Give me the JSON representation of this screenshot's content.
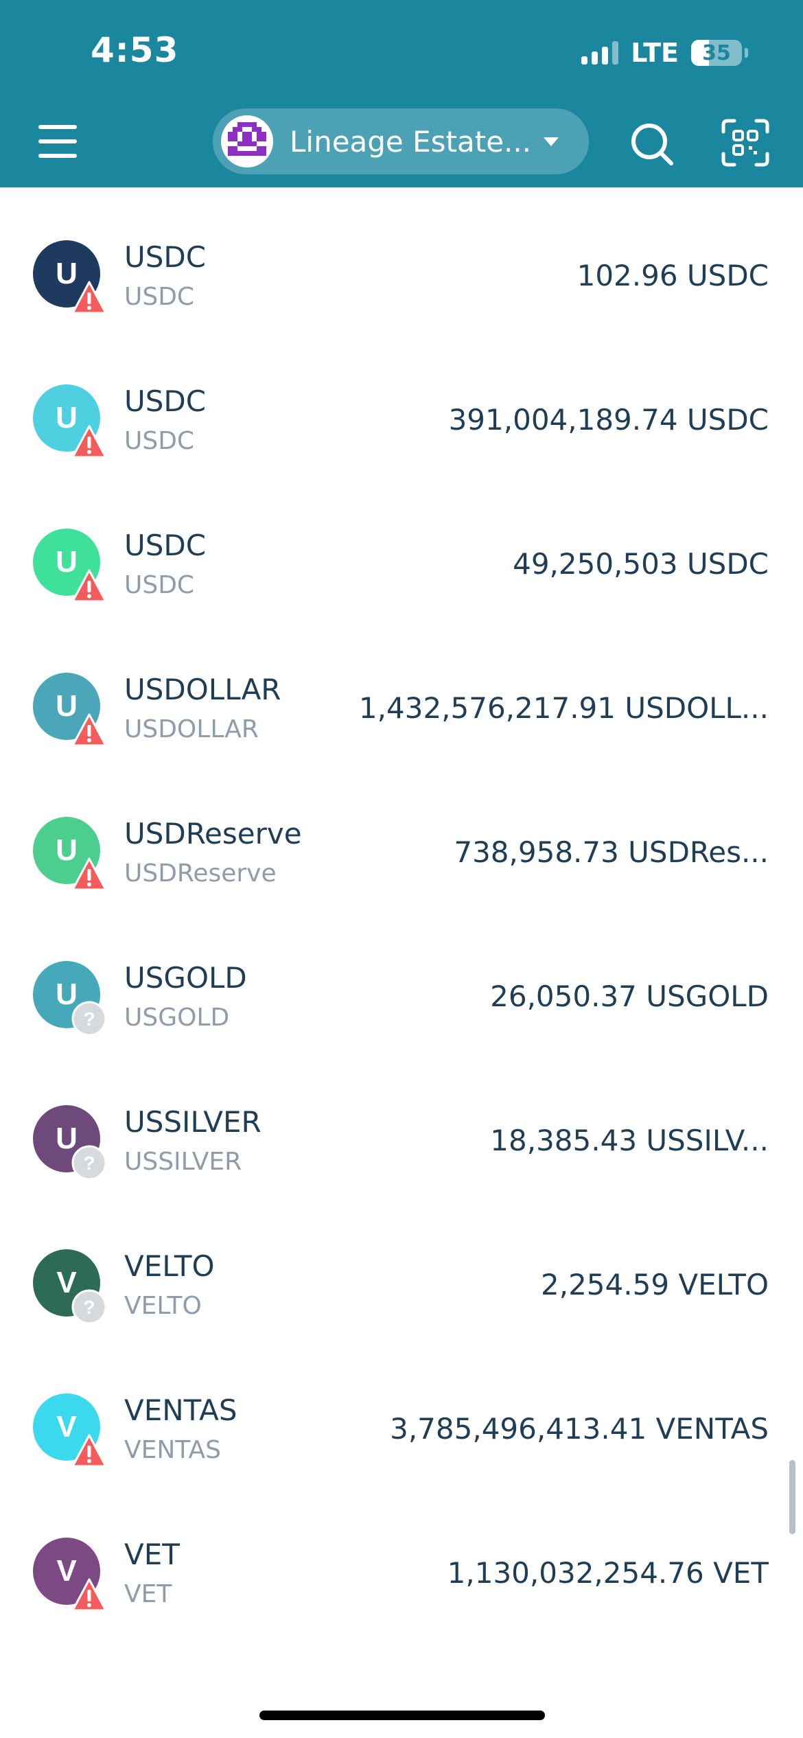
{
  "status_bar": {
    "time": "4:53",
    "network": "LTE",
    "battery": "35",
    "battery_level": 0.35
  },
  "header": {
    "wallet_name": "Lineage Estate...",
    "background_color": "#1b879f",
    "icons": [
      "menu-icon",
      "wallet-avatar",
      "chevron-down-icon",
      "search-icon",
      "scan-icon"
    ]
  },
  "colors": {
    "warning": "#f45b5b",
    "unknown": "#d6dadf",
    "text_primary": "#1f3d54",
    "text_secondary": "#8e9cab"
  },
  "tokens": [
    {
      "letter": "U",
      "name": "USDC",
      "symbol": "USDC",
      "balance": "102.96 USDC",
      "color": "#1e3a5f",
      "status": "warning"
    },
    {
      "letter": "U",
      "name": "USDC",
      "symbol": "USDC",
      "balance": "391,004,189.74 USDC",
      "color": "#4fd0e0",
      "status": "warning"
    },
    {
      "letter": "U",
      "name": "USDC",
      "symbol": "USDC",
      "balance": "49,250,503 USDC",
      "color": "#3fe09a",
      "status": "warning"
    },
    {
      "letter": "U",
      "name": "USDOLLAR",
      "symbol": "USDOLLAR",
      "balance": "1,432,576,217.91 USDOLL...",
      "color": "#4aa6b8",
      "status": "warning"
    },
    {
      "letter": "U",
      "name": "USDReserve",
      "symbol": "USDReserve",
      "balance": "738,958.73 USDRes...",
      "color": "#4cce8e",
      "status": "warning"
    },
    {
      "letter": "U",
      "name": "USGOLD",
      "symbol": "USGOLD",
      "balance": "26,050.37 USGOLD",
      "color": "#45a9b9",
      "status": "unknown"
    },
    {
      "letter": "U",
      "name": "USSILVER",
      "symbol": "USSILVER",
      "balance": "18,385.43 USSILV...",
      "color": "#6e4a7c",
      "status": "unknown"
    },
    {
      "letter": "V",
      "name": "VELTO",
      "symbol": "VELTO",
      "balance": "2,254.59 VELTO",
      "color": "#2e6b56",
      "status": "unknown"
    },
    {
      "letter": "V",
      "name": "VENTAS",
      "symbol": "VENTAS",
      "balance": "3,785,496,413.41 VENTAS",
      "color": "#3bd9ee",
      "status": "warning"
    },
    {
      "letter": "V",
      "name": "VET",
      "symbol": "VET",
      "balance": "1,130,032,254.76 VET",
      "color": "#7c4a83",
      "status": "warning"
    }
  ]
}
